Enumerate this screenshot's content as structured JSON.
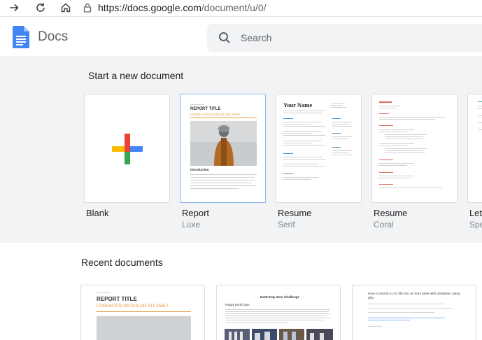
{
  "browser": {
    "url_host": "https://docs.google.com",
    "url_path": "/document/u/0/"
  },
  "header": {
    "app_name": "Docs",
    "search_placeholder": "Search"
  },
  "templates": {
    "section_title": "Start a new document",
    "items": [
      {
        "name": "Blank",
        "sub": ""
      },
      {
        "name": "Report",
        "sub": "Luxe"
      },
      {
        "name": "Resume",
        "sub": "Serif"
      },
      {
        "name": "Resume",
        "sub": "Coral"
      },
      {
        "name": "Let",
        "sub": "Spe"
      }
    ],
    "report_preview": {
      "kicker": "REPORT TITLE",
      "subtitle": "LOREM IPSUM DOLOR SIT AMET",
      "section": "Introduction"
    },
    "resume_preview": {
      "name": "Your Name"
    }
  },
  "recent": {
    "section_title": "Recent documents",
    "docs": [
      {
        "kicker": "REPORT TITLE",
        "subtitle": "LOREM IPSUM DOLOR SIT AMET"
      },
      {
        "title": "Earth Day Zero Challenge",
        "greeting": "Happy Earth Day!"
      },
      {
        "title": "How to import a csv file into an html table with validation using php"
      }
    ]
  },
  "colors": {
    "accent_blue": "#4285f4",
    "google_red": "#ea4335",
    "google_yellow": "#fbbc04",
    "google_green": "#34a853",
    "resume_coral": "#e06c5c",
    "report_orange": "#e6a04b"
  }
}
